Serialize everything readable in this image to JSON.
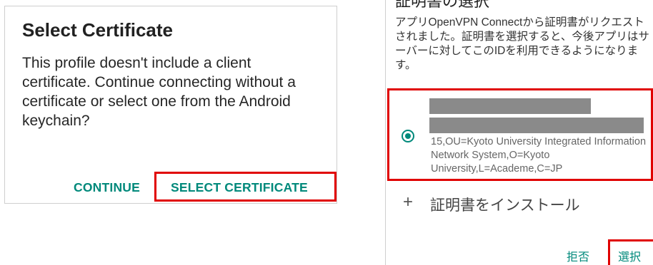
{
  "left_dialog": {
    "title": "Select Certificate",
    "body": "This profile doesn't include a client certificate. Continue connecting without a certificate or select one from the Android keychain?",
    "continue_label": "CONTINUE",
    "select_certificate_label": "SELECT CERTIFICATE"
  },
  "right_dialog": {
    "title": "証明書の選択",
    "body": "アプリOpenVPN Connectから証明書がリクエストされました。証明書を選択すると、今後アプリはサーバーに対してこのIDを利用できるようになります。",
    "certificate": {
      "selected": true,
      "details": "15,OU=Kyoto University Integrated Information Network System,O=Kyoto University,L=Academe,C=JP"
    },
    "install_label": "証明書をインストール",
    "install_icon": "plus-icon",
    "deny_label": "拒否",
    "select_label": "選択"
  },
  "colors": {
    "accent": "#00897b",
    "highlight": "#e00000",
    "redaction": "#8a8a8a"
  }
}
